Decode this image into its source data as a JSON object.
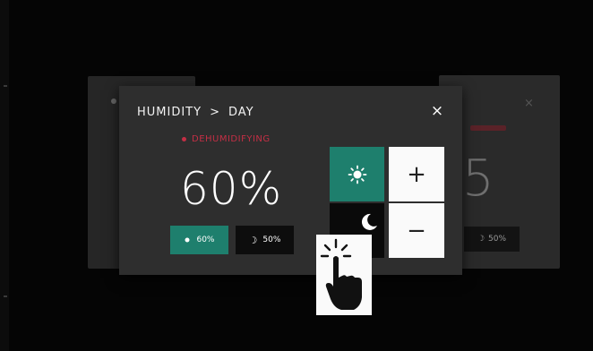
{
  "dialog": {
    "breadcrumb": {
      "section": "HUMIDITY",
      "separator": ">",
      "mode": "DAY"
    },
    "close_label": "×",
    "alert_text": "DEHUMIDIFYING",
    "reading": "60%",
    "day_toggle": {
      "icon": "sun-icon",
      "label": "60%"
    },
    "night_toggle": {
      "icon": "moon-icon",
      "label": "50%"
    }
  },
  "controls": {
    "mode_day_icon": "sun-icon",
    "mode_night_icon": "moon-icon",
    "plus_label": "+",
    "minus_label": "−"
  },
  "background_card": {
    "value": "5",
    "night_toggle": {
      "icon": "moon-icon",
      "label": "50%"
    }
  },
  "colors": {
    "accent": "#1e7f6d",
    "alert": "#c42f45",
    "panel": "#2e2e2e"
  },
  "overlay": {
    "icon": "pointer-hand-icon"
  }
}
